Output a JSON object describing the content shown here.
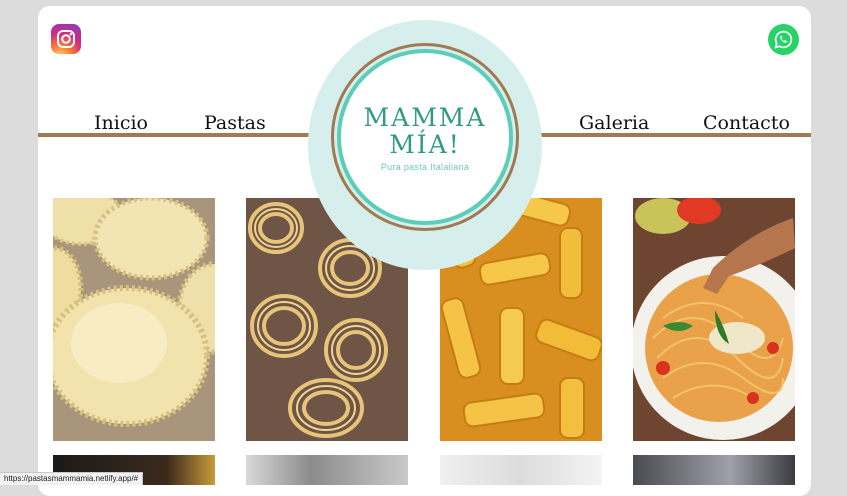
{
  "nav": {
    "inicio": "Inicio",
    "pastas": "Pastas",
    "galeria": "Galeria",
    "contacto": "Contacto"
  },
  "logo": {
    "title_line1": "MAMMA",
    "title_line2": "MÍA!",
    "subtitle": "Pura pasta Italaliana"
  },
  "social": {
    "instagram_icon": "instagram-icon",
    "whatsapp_icon": "whatsapp-icon"
  },
  "gallery": [
    {
      "name": "ravioli-photo"
    },
    {
      "name": "tagliatelle-nests-photo"
    },
    {
      "name": "rigatoni-photo"
    },
    {
      "name": "spaghetti-plate-photo"
    }
  ],
  "status": {
    "url": "https://pastasmammamia.netlify.app/#"
  },
  "colors": {
    "brand_teal": "#2f9a86",
    "ring_teal": "#5bcdb8",
    "ring_brown": "#a07a52",
    "logo_bg": "#d7efec"
  }
}
